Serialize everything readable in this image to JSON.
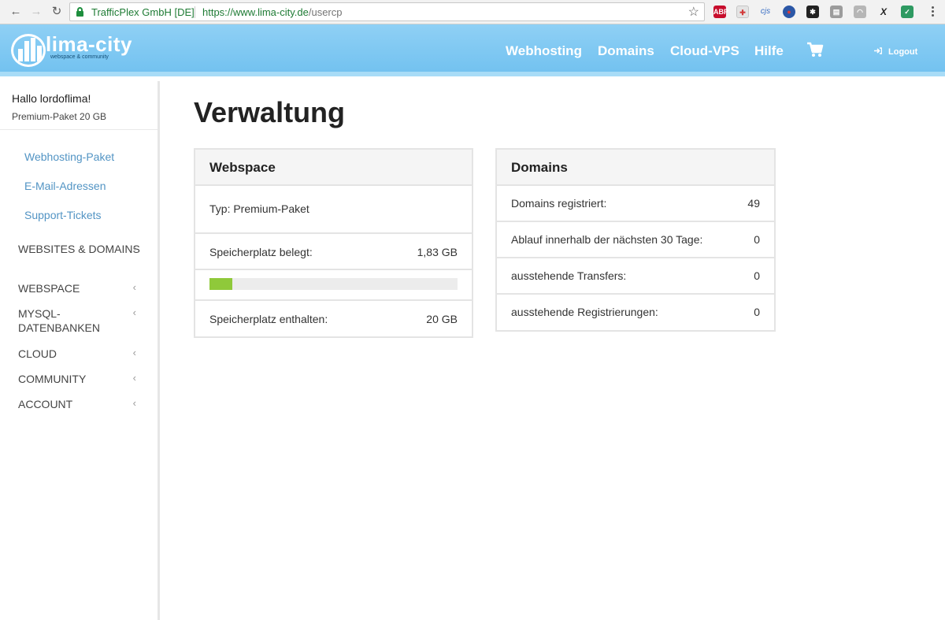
{
  "browser": {
    "back": "←",
    "forward": "→",
    "reload": "↻",
    "certificate": "TrafficPlex GmbH [DE]",
    "url_host": "https://www.lima-city.de",
    "url_path": "/usercp",
    "star": "☆",
    "extensions": [
      {
        "name": "adblock-plus",
        "text": "ABP",
        "color": "#c70d2c"
      },
      {
        "name": "medical-cross",
        "text": "✚",
        "color": "#e4e4e4"
      },
      {
        "name": "cjs",
        "text": "cjs",
        "color": "#f2f2f2"
      },
      {
        "name": "globe",
        "text": "●",
        "color": "#2b57a6"
      },
      {
        "name": "tool",
        "text": "✱",
        "color": "#222222"
      },
      {
        "name": "grid",
        "text": "▤",
        "color": "#9c9c9c"
      },
      {
        "name": "rss",
        "text": "◠",
        "color": "#b6b6b6"
      },
      {
        "name": "x-tool",
        "text": "X",
        "color": "#f2f2f2"
      },
      {
        "name": "shield",
        "text": "✓",
        "color": "#2e9a62"
      }
    ]
  },
  "header": {
    "logo_text": "lima-city",
    "logo_tagline": "webspace & community",
    "nav": [
      "Webhosting",
      "Domains",
      "Cloud-VPS",
      "Hilfe"
    ],
    "logout": "Logout",
    "brand_color": "#73c2f0"
  },
  "sidebar": {
    "greeting": "Hallo lordoflima!",
    "package": "Premium-Paket 20 GB",
    "links": [
      "Webhosting-Paket",
      "E-Mail-Adressen",
      "Support-Tickets"
    ],
    "groups": [
      {
        "label": "WEBSITES & DOMAINS",
        "chevron": "‹"
      },
      {
        "label": "WEBSPACE",
        "chevron": "‹"
      },
      {
        "label": "MYSQL-DATENBANKEN",
        "chevron": "‹"
      },
      {
        "label": "CLOUD",
        "chevron": "‹"
      },
      {
        "label": "COMMUNITY",
        "chevron": "‹"
      },
      {
        "label": "ACCOUNT",
        "chevron": "‹"
      }
    ]
  },
  "main": {
    "title": "Verwaltung",
    "webspace": {
      "title": "Webspace",
      "type": "Typ: Premium-Paket",
      "used_label": "Speicherplatz belegt:",
      "used_value": "1,83 GB",
      "usage_fraction": 0.0915,
      "included_label": "Speicherplatz enthalten:",
      "included_value": "20 GB",
      "bar_color": "#8fc93a"
    },
    "domains": {
      "title": "Domains",
      "rows": [
        {
          "label": "Domains registriert:",
          "value": "49"
        },
        {
          "label": "Ablauf innerhalb der nächsten 30 Tage:",
          "value": "0"
        },
        {
          "label": "ausstehende Transfers:",
          "value": "0"
        },
        {
          "label": "ausstehende Registrierungen:",
          "value": "0"
        }
      ]
    }
  }
}
